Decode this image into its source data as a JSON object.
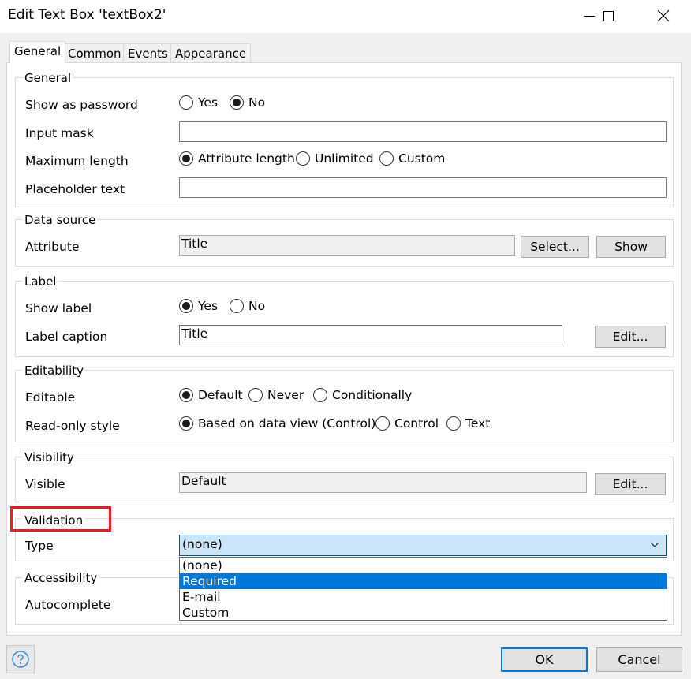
{
  "window": {
    "title": "Edit Text Box 'textBox2'"
  },
  "tabs": [
    "General",
    "Common",
    "Events",
    "Appearance"
  ],
  "general": {
    "legend": "General",
    "show_password": {
      "label": "Show as password",
      "options": [
        "Yes",
        "No"
      ]
    },
    "input_mask": {
      "label": "Input mask",
      "value": ""
    },
    "max_length": {
      "label": "Maximum length",
      "options": [
        "Attribute length",
        "Unlimited",
        "Custom"
      ]
    },
    "placeholder": {
      "label": "Placeholder text",
      "value": ""
    }
  },
  "datasource": {
    "legend": "Data source",
    "attribute_label": "Attribute",
    "attribute_value": "Title",
    "select_button": "Select...",
    "show_button": "Show"
  },
  "label_group": {
    "legend": "Label",
    "show_label": {
      "label": "Show label",
      "options": [
        "Yes",
        "No"
      ]
    },
    "caption": {
      "label": "Label caption",
      "value": "Title",
      "edit_button": "Edit..."
    }
  },
  "editability": {
    "legend": "Editability",
    "editable": {
      "label": "Editable",
      "options": [
        "Default",
        "Never",
        "Conditionally"
      ]
    },
    "readonly": {
      "label": "Read-only style",
      "options": [
        "Based on data view (Control)",
        "Control",
        "Text"
      ]
    }
  },
  "visibility": {
    "legend": "Visibility",
    "visible_label": "Visible",
    "visible_value": "Default",
    "edit_button": "Edit..."
  },
  "validation": {
    "legend": "Validation",
    "type_label": "Type",
    "selected": "(none)",
    "options": [
      "(none)",
      "Required",
      "E-mail",
      "Custom"
    ],
    "highlighted": "Required"
  },
  "accessibility": {
    "legend": "Accessibility",
    "autocomplete_label": "Autocomplete"
  },
  "footer": {
    "ok": "OK",
    "cancel": "Cancel"
  },
  "colors": {
    "highlight_box": "#e3202a",
    "selection": "#0078d7",
    "combo_bg": "#cce4f7"
  }
}
